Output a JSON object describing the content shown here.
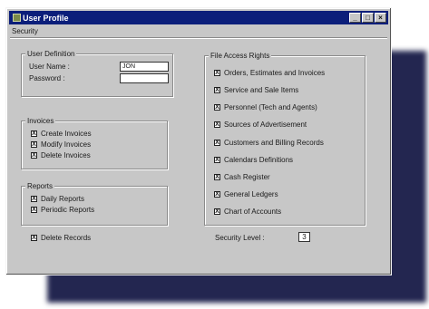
{
  "window": {
    "title": "User Profile",
    "buttons": {
      "minimize": "_",
      "maximize": "□",
      "close": "×"
    }
  },
  "menu": {
    "security": "Security"
  },
  "user_definition": {
    "title": "User Definition",
    "user_name_label": "User Name :",
    "user_name_value": "JON",
    "password_label": "Password :",
    "password_value": ""
  },
  "invoices": {
    "title": "Invoices",
    "items": [
      {
        "label": "Create Invoices",
        "checked": true
      },
      {
        "label": "Modify Invoices",
        "checked": true
      },
      {
        "label": "Delete Invoices",
        "checked": true
      }
    ]
  },
  "reports": {
    "title": "Reports",
    "items": [
      {
        "label": "Daily Reports",
        "checked": true
      },
      {
        "label": "Periodic Reports",
        "checked": true
      }
    ]
  },
  "delete_records": {
    "label": "Delete Records",
    "checked": true
  },
  "file_access": {
    "title": "File Access Rights",
    "items": [
      {
        "label": "Orders, Estimates and Invoices",
        "checked": true
      },
      {
        "label": "Service and Sale Items",
        "checked": true
      },
      {
        "label": "Personnel (Tech and Agents)",
        "checked": true
      },
      {
        "label": "Sources of Advertisement",
        "checked": true
      },
      {
        "label": "Customers and Billing Records",
        "checked": true
      },
      {
        "label": "Calendars Definitions",
        "checked": true
      },
      {
        "label": "Cash Register",
        "checked": true
      },
      {
        "label": "General Ledgers",
        "checked": true
      },
      {
        "label": "Chart of Accounts",
        "checked": true
      }
    ]
  },
  "security_level": {
    "label": "Security Level :",
    "value": "3"
  },
  "checkmark": "X"
}
